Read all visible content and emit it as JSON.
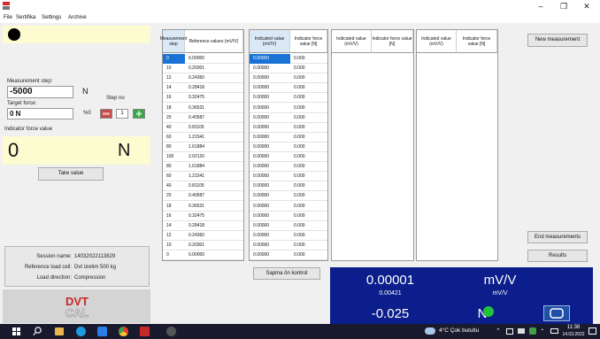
{
  "window": {
    "title": "",
    "minimize": "–",
    "maximize": "❐",
    "close": "✕"
  },
  "menu": [
    "File",
    "Sertifika",
    "Settings",
    "Archive"
  ],
  "left": {
    "measurement_step_label": "Measurement step:",
    "measurement_step_value": "-5000",
    "measurement_step_unit": "N",
    "step_no_label": "Step no",
    "target_force_label": "Target force:",
    "target_force_value": "0 N",
    "percent_label": "%0",
    "step_no_value": "1",
    "indicator_force_label": "Indicator force value",
    "indicator_force_value": "0",
    "indicator_force_unit": "N",
    "take_value_label": "Take value",
    "session_name_label": "Session name:",
    "session_name_value": "14032022113829",
    "reference_cell_label": "Reference load cell:",
    "reference_cell_value": "Dvt üretim 500 kg",
    "load_direction_label": "Load direction:",
    "load_direction_value": "Compression",
    "logo_text": "DVT CAL"
  },
  "table1": {
    "headers": [
      "Measurement step",
      "Reference values (mV/V)"
    ],
    "rows": [
      [
        "0",
        "0.00000"
      ],
      [
        "10",
        "0.20301"
      ],
      [
        "12",
        "0.24360"
      ],
      [
        "14",
        "0.28418"
      ],
      [
        "16",
        "0.32475"
      ],
      [
        "18",
        "0.36531"
      ],
      [
        "20",
        "0.40587"
      ],
      [
        "40",
        "0.81105"
      ],
      [
        "60",
        "1.21541"
      ],
      [
        "80",
        "1.61884"
      ],
      [
        "100",
        "2.02120"
      ],
      [
        "80",
        "1.61884"
      ],
      [
        "60",
        "1.21541"
      ],
      [
        "40",
        "0.81105"
      ],
      [
        "20",
        "0.40587"
      ],
      [
        "18",
        "0.36531"
      ],
      [
        "16",
        "0.32475"
      ],
      [
        "14",
        "0.28418"
      ],
      [
        "12",
        "0.24360"
      ],
      [
        "10",
        "0.20301"
      ],
      [
        "0",
        "0.00000"
      ]
    ]
  },
  "table2": {
    "headers": [
      "Indicated value (mV/V)",
      "Indicator force value [N]"
    ],
    "rows": [
      [
        "0.00000",
        "0.000"
      ],
      [
        "0.00000",
        "0.000"
      ],
      [
        "0.00000",
        "0.000"
      ],
      [
        "0.00000",
        "0.000"
      ],
      [
        "0.00000",
        "0.000"
      ],
      [
        "0.00000",
        "0.000"
      ],
      [
        "0.00000",
        "0.000"
      ],
      [
        "0.00000",
        "0.000"
      ],
      [
        "0.00000",
        "0.000"
      ],
      [
        "0.00000",
        "0.000"
      ],
      [
        "0.00000",
        "0.000"
      ],
      [
        "0.00000",
        "0.000"
      ],
      [
        "0.00000",
        "0.000"
      ],
      [
        "0.00000",
        "0.000"
      ],
      [
        "0.00000",
        "0.000"
      ],
      [
        "0.00000",
        "0.000"
      ],
      [
        "0.00000",
        "0.000"
      ],
      [
        "0.00000",
        "0.000"
      ],
      [
        "0.00000",
        "0.000"
      ],
      [
        "0.00000",
        "0.000"
      ],
      [
        "0.00000",
        "0.000"
      ]
    ]
  },
  "table3": {
    "headers": [
      "Indicated value (mV/V)",
      "Indicator force value [N]"
    ]
  },
  "table4": {
    "headers": [
      "Indicated value (mV/V)",
      "Indicator force value [N]"
    ]
  },
  "kontrol_label": "Sapma ön kontrol",
  "display": {
    "value_main": "0.00001",
    "unit_main": "mV/V",
    "value_sub": "0.00421",
    "unit_sub": "mV/V",
    "force_value": "-0.025",
    "force_unit": "N"
  },
  "right": {
    "new_measurement": "New measurement",
    "end_measurements": "End measurements",
    "results": "Results"
  },
  "taskbar": {
    "weather": "4°C  Çok bulutlu",
    "time": "11:38",
    "date": "14.03.2022"
  },
  "colors": {
    "accent": "#0b1e8b",
    "selected": "#1a73d4",
    "yellow": "#fdfbd0",
    "status_dot": "#22c33a"
  }
}
